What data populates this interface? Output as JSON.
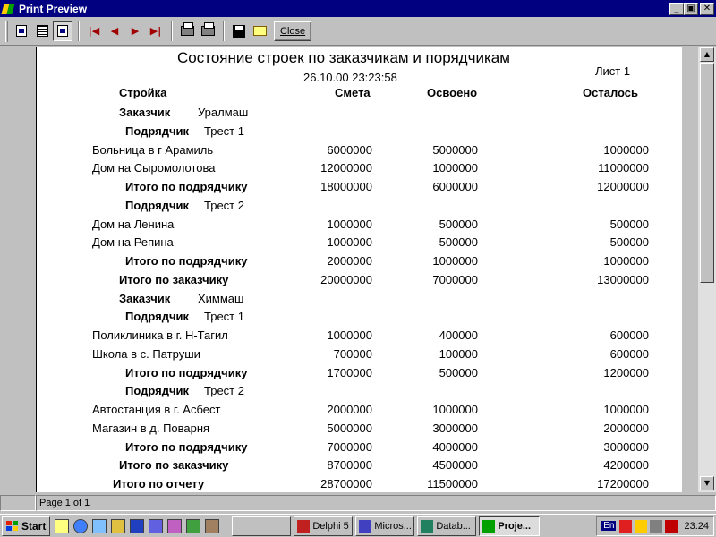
{
  "window": {
    "title": "Print Preview",
    "minimize": "_",
    "maximize": "▣",
    "close": "✕"
  },
  "toolbar": {
    "close_label": "Close"
  },
  "report": {
    "title": "Состояние строек по заказчикам и порядчикам",
    "datetime": "26.10.00 23:23:58",
    "sheet": "Лист 1",
    "headers": {
      "site": "Стройка",
      "estimate": "Смета",
      "spent": "Освоено",
      "remaining": "Осталось"
    },
    "lines": [
      {
        "kind": "customer",
        "label": "Заказчик",
        "name": "Уралмаш"
      },
      {
        "kind": "contractor",
        "label": "Подрядчик",
        "name": "Трест 1"
      },
      {
        "kind": "item",
        "name": "Больница в г Арамиль",
        "estimate": "6000000",
        "spent": "5000000",
        "remaining": "1000000"
      },
      {
        "kind": "item",
        "name": "Дом на Сыромолотова",
        "estimate": "12000000",
        "spent": "1000000",
        "remaining": "11000000"
      },
      {
        "kind": "subtotal",
        "name": "Итого по подрядчику",
        "estimate": "18000000",
        "spent": "6000000",
        "remaining": "12000000"
      },
      {
        "kind": "contractor",
        "label": "Подрядчик",
        "name": "Трест 2"
      },
      {
        "kind": "item",
        "name": "Дом на Ленина",
        "estimate": "1000000",
        "spent": "500000",
        "remaining": "500000"
      },
      {
        "kind": "item",
        "name": "Дом на Репина",
        "estimate": "1000000",
        "spent": "500000",
        "remaining": "500000"
      },
      {
        "kind": "subtotal",
        "name": "Итого по подрядчику",
        "estimate": "2000000",
        "spent": "1000000",
        "remaining": "1000000"
      },
      {
        "kind": "custtotal",
        "name": "Итого по заказчику",
        "estimate": "20000000",
        "spent": "7000000",
        "remaining": "13000000"
      },
      {
        "kind": "customer",
        "label": "Заказчик",
        "name": "Химмаш"
      },
      {
        "kind": "contractor",
        "label": "Подрядчик",
        "name": "Трест 1"
      },
      {
        "kind": "item",
        "name": "Поликлиника в г. Н-Тагил",
        "estimate": "1000000",
        "spent": "400000",
        "remaining": "600000"
      },
      {
        "kind": "item",
        "name": "Школа в с. Патруши",
        "estimate": "700000",
        "spent": "100000",
        "remaining": "600000"
      },
      {
        "kind": "subtotal",
        "name": "Итого по подрядчику",
        "estimate": "1700000",
        "spent": "500000",
        "remaining": "1200000"
      },
      {
        "kind": "contractor",
        "label": "Подрядчик",
        "name": "Трест 2"
      },
      {
        "kind": "item",
        "name": "Автостанция в г. Асбест",
        "estimate": "2000000",
        "spent": "1000000",
        "remaining": "1000000"
      },
      {
        "kind": "item",
        "name": "Магазин в д. Поварня",
        "estimate": "5000000",
        "spent": "3000000",
        "remaining": "2000000"
      },
      {
        "kind": "subtotal",
        "name": "Итого по подрядчику",
        "estimate": "7000000",
        "spent": "4000000",
        "remaining": "3000000"
      },
      {
        "kind": "custtotal",
        "name": "Итого по заказчику",
        "estimate": "8700000",
        "spent": "4500000",
        "remaining": "4200000"
      },
      {
        "kind": "grandtotal",
        "name": "Итого по отчету",
        "estimate": "28700000",
        "spent": "11500000",
        "remaining": "17200000"
      }
    ]
  },
  "statusbar": {
    "left": "",
    "page": "Page 1 of 1"
  },
  "taskbar": {
    "start": "Start",
    "buttons": [
      "",
      "Delphi 5",
      "Micros...",
      "Datab...",
      "Proje..."
    ],
    "lang": "En",
    "clock": "23:24"
  }
}
